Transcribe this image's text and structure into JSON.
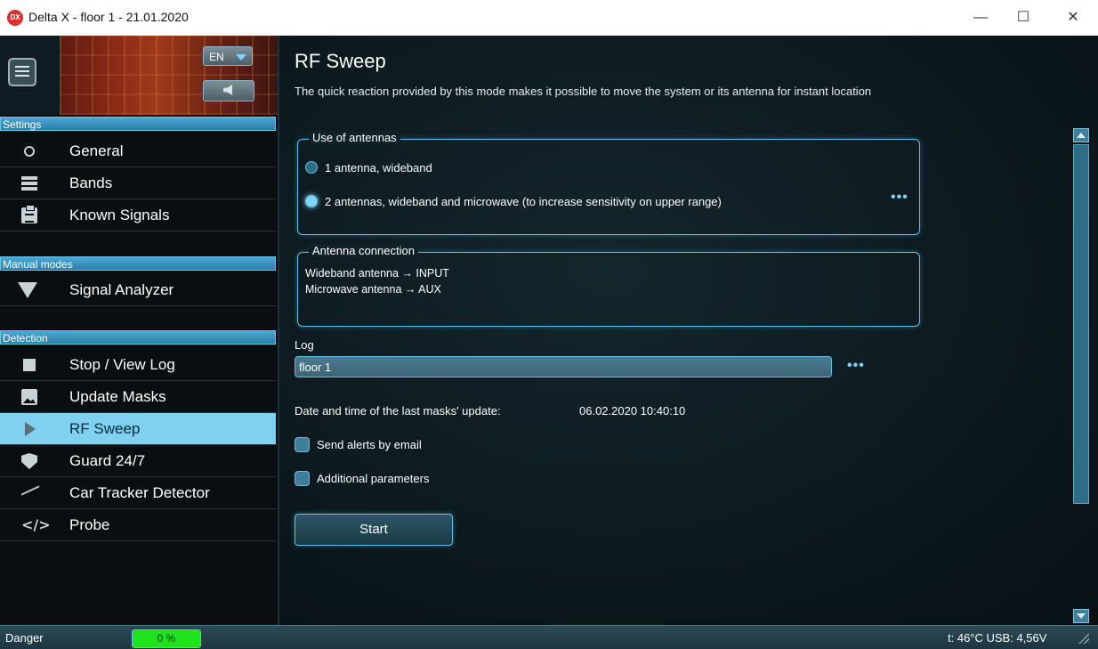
{
  "window": {
    "title": "Delta X - floor 1 - 21.01.2020",
    "logo_text": "DX",
    "minimize": "—",
    "maximize": "☐",
    "close": "✕"
  },
  "header": {
    "language": "EN"
  },
  "sidebar": {
    "sections": [
      {
        "title": "Settings",
        "items": [
          {
            "label": "General",
            "icon": "gear-icon"
          },
          {
            "label": "Bands",
            "icon": "list-icon"
          },
          {
            "label": "Known Signals",
            "icon": "clipboard-icon"
          }
        ]
      },
      {
        "title": "Manual modes",
        "items": [
          {
            "label": "Signal Analyzer",
            "icon": "wifi-icon"
          }
        ]
      },
      {
        "title": "Detection",
        "items": [
          {
            "label": "Stop / View Log",
            "icon": "stop-icon"
          },
          {
            "label": "Update Masks",
            "icon": "image-icon"
          },
          {
            "label": "RF Sweep",
            "icon": "play-icon",
            "active": true
          },
          {
            "label": "Guard 24/7",
            "icon": "shield-icon"
          },
          {
            "label": "Car Tracker Detector",
            "icon": "trend-icon"
          },
          {
            "label": "Probe",
            "icon": "code-icon"
          }
        ]
      }
    ]
  },
  "main": {
    "title": "RF Sweep",
    "subtitle": "The quick reaction provided by this mode makes it possible to move the system or its antenna for instant location",
    "antennas": {
      "legend": "Use of antennas",
      "options": [
        {
          "label": "1 antenna, wideband",
          "checked": false
        },
        {
          "label": "2 antennas, wideband and microwave (to increase sensitivity on upper range)",
          "checked": true
        }
      ],
      "more": "•••"
    },
    "connection": {
      "legend": "Antenna connection",
      "lines": [
        "Wideband antenna → INPUT",
        "Microwave antenna → AUX"
      ]
    },
    "log": {
      "label": "Log",
      "value": "floor 1",
      "more": "•••"
    },
    "masks_update": {
      "label": "Date and time of the last masks' update:",
      "value": "06.02.2020 10:40:10"
    },
    "checkboxes": [
      {
        "label": "Send alerts by email",
        "checked": false
      },
      {
        "label": "Additional parameters",
        "checked": false
      }
    ],
    "start_label": "Start"
  },
  "status": {
    "danger_label": "Danger",
    "danger_value": "0 %",
    "danger_fraction": 1.0,
    "system_info": "t: 46°C  USB: 4,56V"
  },
  "colors": {
    "accent": "#5cc0e8",
    "active_nav": "#7fd1ef",
    "danger_fill": "#1ee21e"
  }
}
